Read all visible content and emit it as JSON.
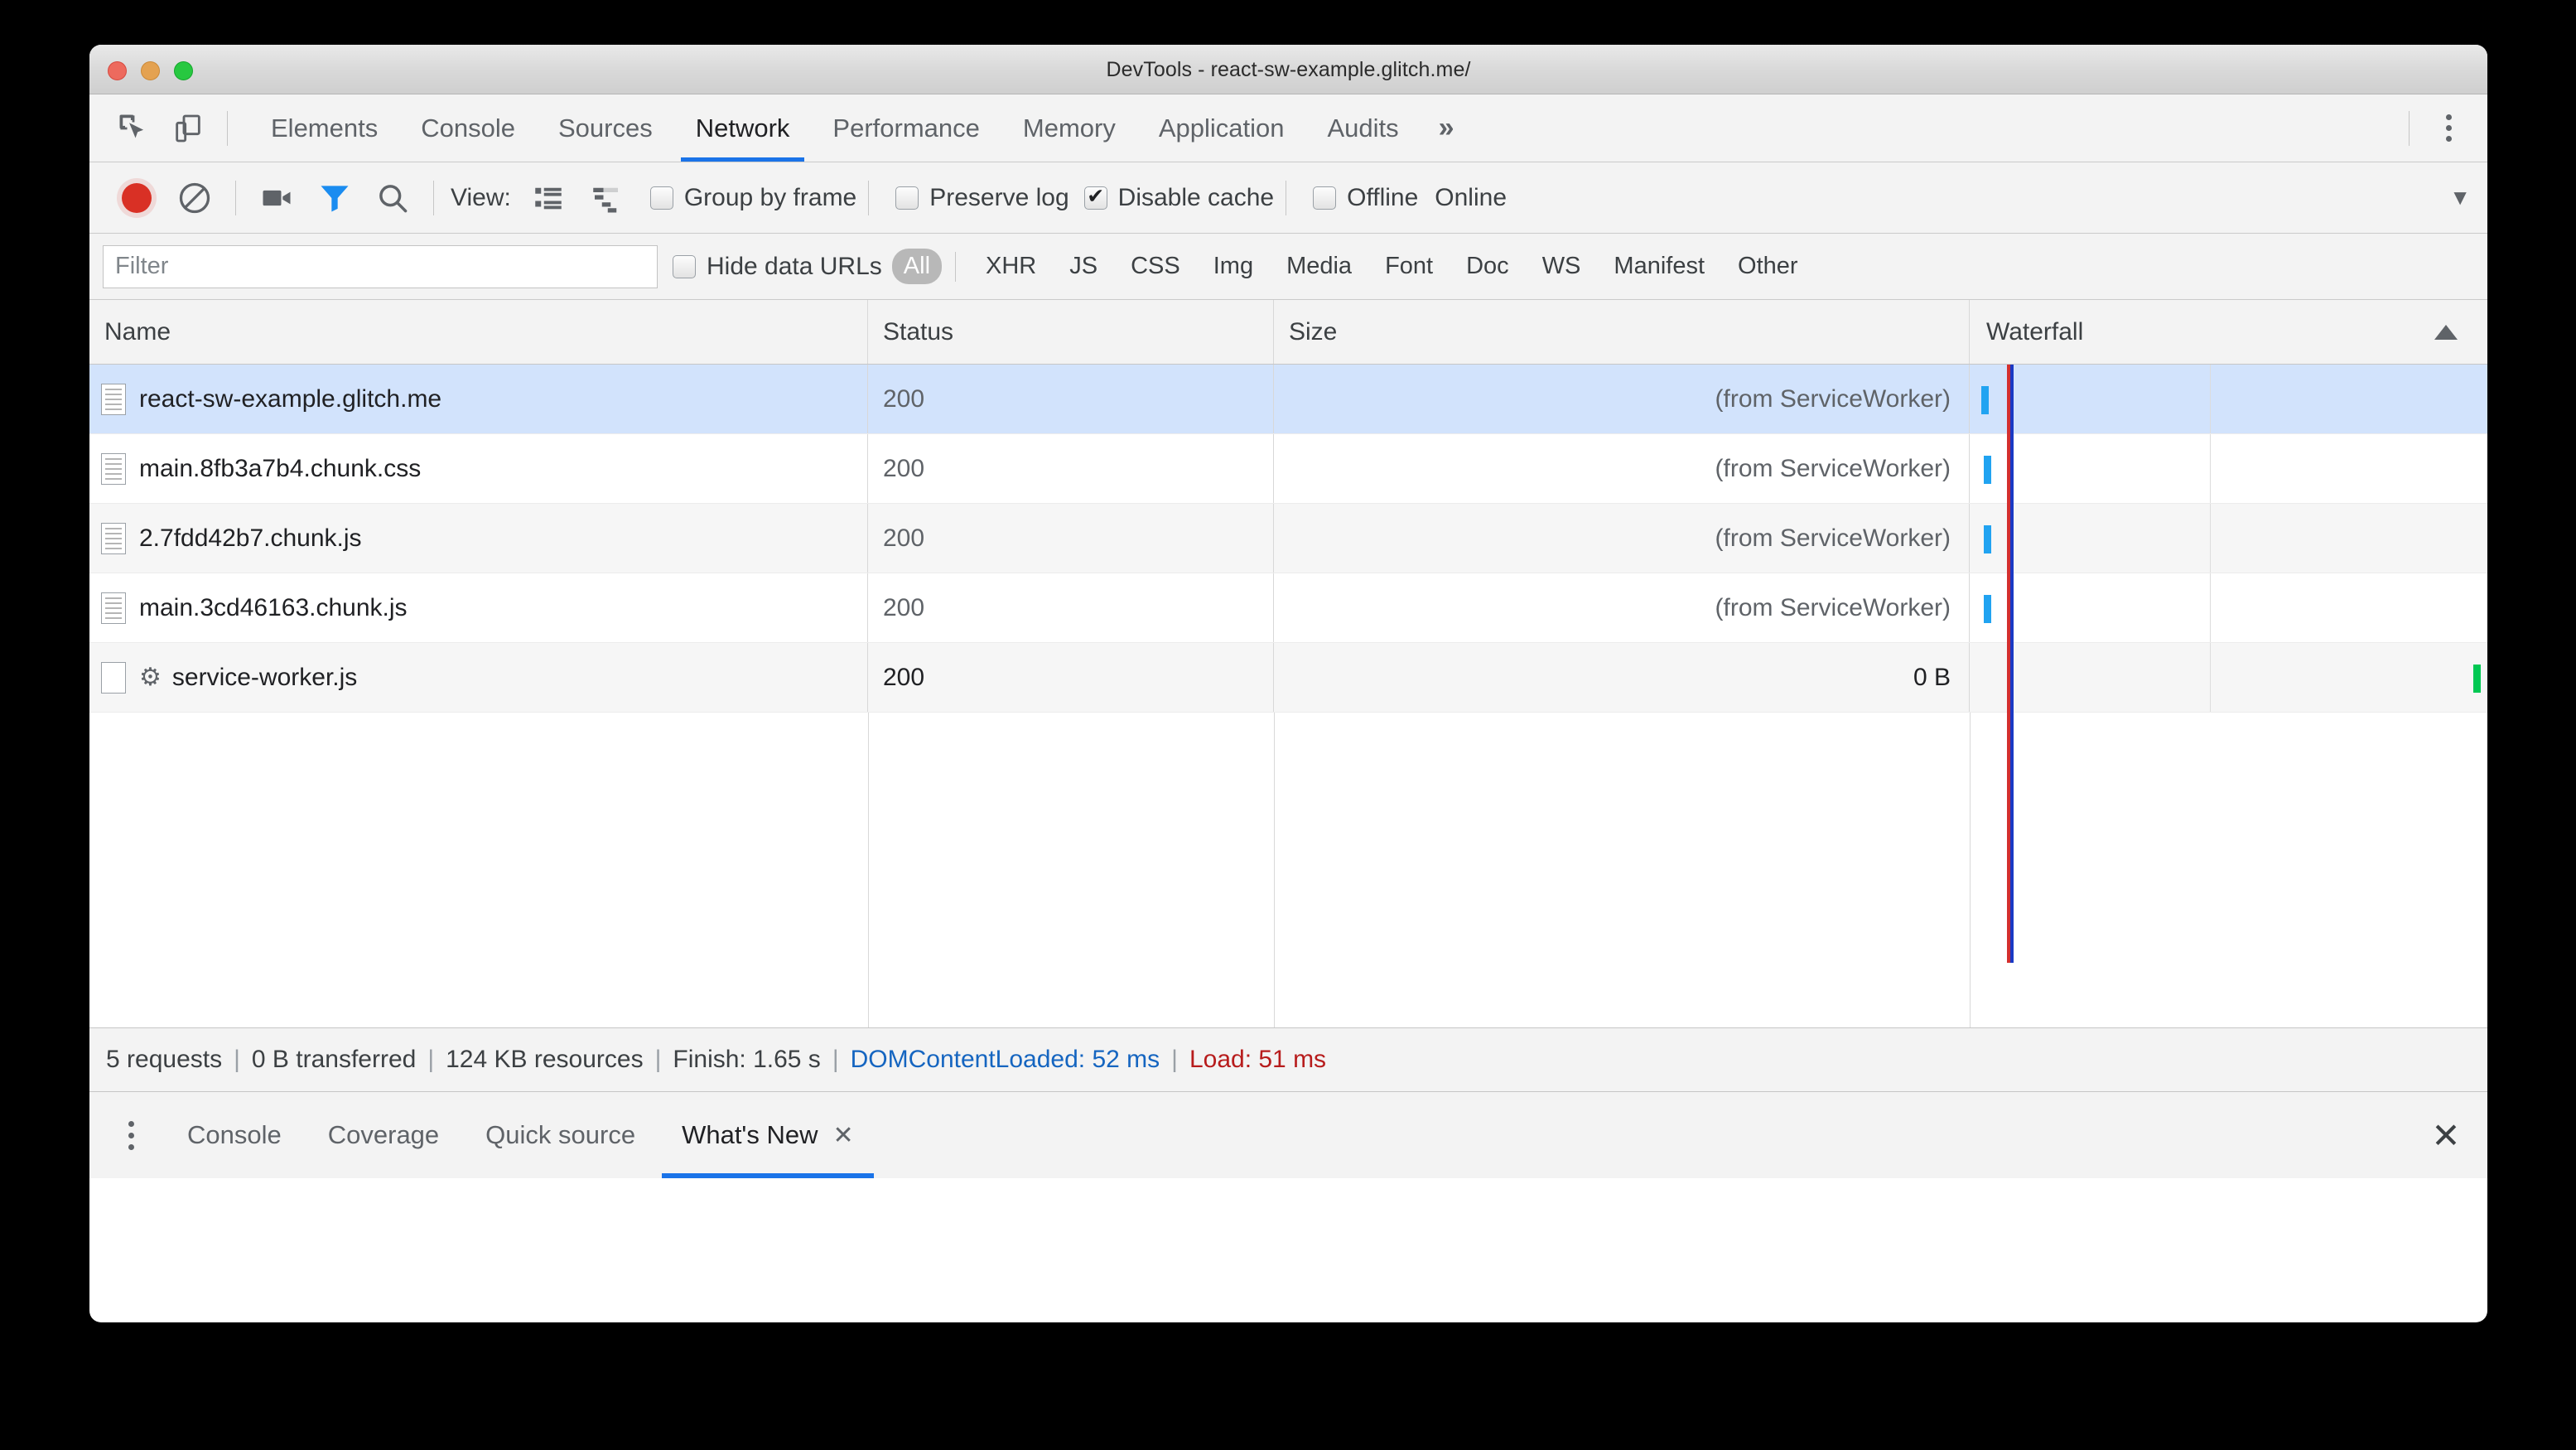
{
  "window": {
    "title": "DevTools - react-sw-example.glitch.me/",
    "traffic": {
      "close": "close",
      "minimize": "minimize",
      "maximize": "maximize"
    }
  },
  "main_tabs": {
    "items": [
      {
        "label": "Elements",
        "active": false
      },
      {
        "label": "Console",
        "active": false
      },
      {
        "label": "Sources",
        "active": false
      },
      {
        "label": "Network",
        "active": true
      },
      {
        "label": "Performance",
        "active": false
      },
      {
        "label": "Memory",
        "active": false
      },
      {
        "label": "Application",
        "active": false
      },
      {
        "label": "Audits",
        "active": false
      }
    ],
    "overflow": "»",
    "inspect_icon": "inspect-element-icon",
    "device_icon": "device-toolbar-icon",
    "kebab_icon": "more-options-icon"
  },
  "network_toolbar": {
    "record_icon": "record-button",
    "clear_icon": "clear-icon",
    "capture_screenshots_icon": "camera-icon",
    "filter_icon": "filter-icon",
    "search_icon": "search-icon",
    "view_label": "View:",
    "list_view_icon": "list-view-icon",
    "waterfall_view_icon": "waterfall-view-icon",
    "group_by_frame": {
      "label": "Group by frame",
      "checked": false
    },
    "preserve_log": {
      "label": "Preserve log",
      "checked": false
    },
    "disable_cache": {
      "label": "Disable cache",
      "checked": true
    },
    "offline": {
      "label": "Offline",
      "checked": false
    },
    "throttle_value": "Online",
    "throttle_arrow": "▼"
  },
  "filter_bar": {
    "filter_placeholder": "Filter",
    "filter_value": "",
    "hide_data_urls": {
      "label": "Hide data URLs",
      "checked": false
    },
    "types": [
      {
        "label": "All",
        "selected": true
      },
      {
        "label": "XHR",
        "selected": false
      },
      {
        "label": "JS",
        "selected": false
      },
      {
        "label": "CSS",
        "selected": false
      },
      {
        "label": "Img",
        "selected": false
      },
      {
        "label": "Media",
        "selected": false
      },
      {
        "label": "Font",
        "selected": false
      },
      {
        "label": "Doc",
        "selected": false
      },
      {
        "label": "WS",
        "selected": false
      },
      {
        "label": "Manifest",
        "selected": false
      },
      {
        "label": "Other",
        "selected": false
      }
    ]
  },
  "table": {
    "columns": [
      {
        "key": "name",
        "label": "Name"
      },
      {
        "key": "status",
        "label": "Status"
      },
      {
        "key": "size",
        "label": "Size"
      },
      {
        "key": "waterfall",
        "label": "Waterfall",
        "sorted": "asc",
        "sort_arrow": "▲"
      }
    ],
    "rows": [
      {
        "name": "react-sw-example.glitch.me",
        "status": "200",
        "size": "(from ServiceWorker)",
        "icon": "document-icon",
        "selected": true,
        "bar_color": "#21a3f1",
        "bar_left_pct": 1.2
      },
      {
        "name": "main.8fb3a7b4.chunk.css",
        "status": "200",
        "size": "(from ServiceWorker)",
        "icon": "document-icon",
        "selected": false,
        "bar_color": "#21a3f1",
        "bar_left_pct": 1.6
      },
      {
        "name": "2.7fdd42b7.chunk.js",
        "status": "200",
        "size": "(from ServiceWorker)",
        "icon": "document-icon",
        "selected": false,
        "bar_color": "#21a3f1",
        "bar_left_pct": 1.6
      },
      {
        "name": "main.3cd46163.chunk.js",
        "status": "200",
        "size": "(from ServiceWorker)",
        "icon": "document-icon",
        "selected": false,
        "bar_color": "#21a3f1",
        "bar_left_pct": 1.6
      },
      {
        "name": "service-worker.js",
        "status": "200",
        "size": "0 B",
        "icon": "gear-icon",
        "selected": false,
        "bar_color": "#00c853",
        "bar_left_pct": 96.5
      }
    ]
  },
  "summary": {
    "requests": "5 requests",
    "transferred": "0 B transferred",
    "resources": "124 KB resources",
    "finish": "Finish: 1.65 s",
    "dom_content_loaded": "DOMContentLoaded: 52 ms",
    "load": "Load: 51 ms",
    "separator": "|",
    "dcl_color": "#1565c0",
    "load_color": "#b71c1c"
  },
  "drawer": {
    "kebab_icon": "more-tools-icon",
    "tabs": [
      {
        "label": "Console",
        "active": false,
        "closable": false
      },
      {
        "label": "Coverage",
        "active": false,
        "closable": false
      },
      {
        "label": "Quick source",
        "active": false,
        "closable": false
      },
      {
        "label": "What's New",
        "active": true,
        "closable": true
      }
    ],
    "tab_close_icon": "✕",
    "close_icon": "✕"
  },
  "accent_colors": {
    "tab_underline": "#1a73e8",
    "selected_row": "#d2e3fc",
    "record": "#d93025",
    "waterfall_blue": "#21a3f1",
    "waterfall_green": "#00c853",
    "dcl_line": "#1a39c4",
    "load_line": "#d32f2f"
  }
}
